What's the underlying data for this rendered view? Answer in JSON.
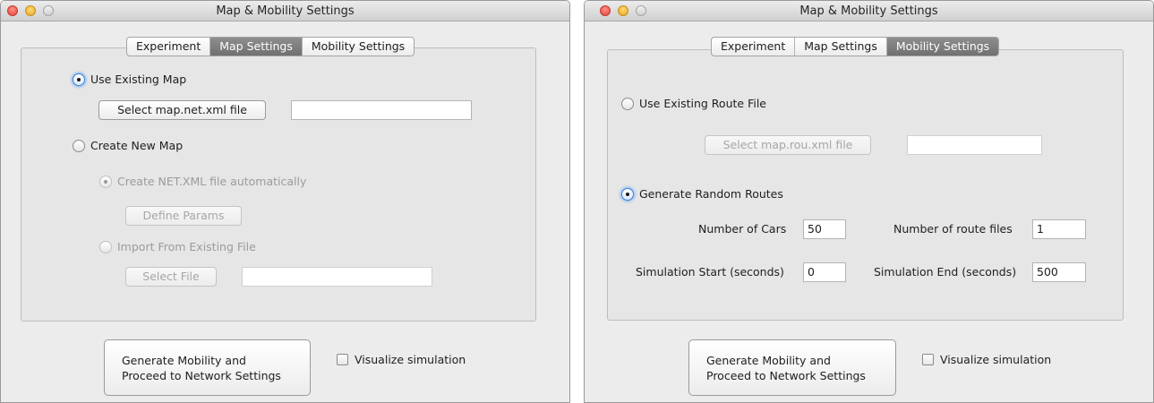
{
  "left": {
    "title": "Map & Mobility Settings",
    "tabs": [
      "Experiment",
      "Map Settings",
      "Mobility Settings"
    ],
    "use_existing_map": "Use Existing Map",
    "select_map_net": "Select map.net.xml file",
    "map_net_value": "",
    "create_new_map": "Create New Map",
    "create_netxml_auto": "Create NET.XML file automatically",
    "define_params": "Define Params",
    "import_existing": "Import From Existing File",
    "select_file": "Select File",
    "import_file_value": "",
    "generate_line1": "Generate Mobility and",
    "generate_line2": "Proceed to Network Settings",
    "visualize": "Visualize simulation"
  },
  "right": {
    "title": "Map & Mobility Settings",
    "tabs": [
      "Experiment",
      "Map Settings",
      "Mobility Settings"
    ],
    "use_existing_route": "Use Existing Route File",
    "select_map_rou": "Select map.rou.xml file",
    "map_rou_value": "",
    "generate_random_routes": "Generate Random Routes",
    "number_of_cars_label": "Number of Cars",
    "number_of_cars_value": "50",
    "number_of_route_files_label": "Number of route files",
    "number_of_route_files_value": "1",
    "sim_start_label": "Simulation Start (seconds)",
    "sim_start_value": "0",
    "sim_end_label": "Simulation End (seconds)",
    "sim_end_value": "500",
    "generate_line1": "Generate Mobility and",
    "generate_line2": "Proceed to Network Settings",
    "visualize": "Visualize simulation"
  },
  "colors": {
    "window_bg": "#ececec",
    "active_tab": "#7f7f7f",
    "focus_ring": "#3d80d8",
    "disabled_text": "#9b9b9b"
  }
}
